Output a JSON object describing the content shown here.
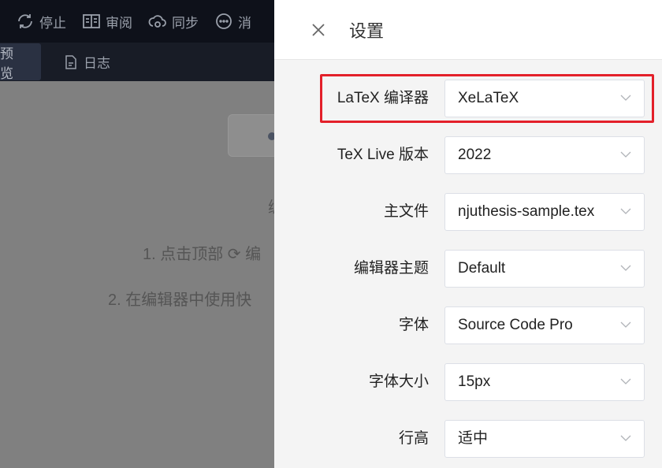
{
  "toolbar": {
    "items": [
      {
        "label": "停止",
        "icon": "refresh-icon"
      },
      {
        "label": "审阅",
        "icon": "book-icon"
      },
      {
        "label": "同步",
        "icon": "cloud-sync-icon"
      },
      {
        "label": "消",
        "icon": "chat-icon"
      }
    ]
  },
  "tabs": [
    {
      "label": "预览",
      "active": true
    },
    {
      "label": "日志",
      "icon": "document-icon"
    }
  ],
  "main": {
    "lines": [
      "编",
      "1. 点击顶部 ⟳ 编",
      "2. 在编辑器中使用快"
    ]
  },
  "drawer": {
    "title": "设置",
    "settings": [
      {
        "label": "LaTeX 编译器",
        "value": "XeLaTeX"
      },
      {
        "label": "TeX Live 版本",
        "value": "2022"
      },
      {
        "label": "主文件",
        "value": "njuthesis-sample.tex"
      },
      {
        "label": "编辑器主题",
        "value": "Default"
      },
      {
        "label": "字体",
        "value": "Source Code Pro"
      },
      {
        "label": "字体大小",
        "value": "15px"
      },
      {
        "label": "行高",
        "value": "适中"
      }
    ]
  },
  "colors": {
    "highlight": "#e3202a",
    "topbar": "#0e111a",
    "overlay": "#808080"
  }
}
